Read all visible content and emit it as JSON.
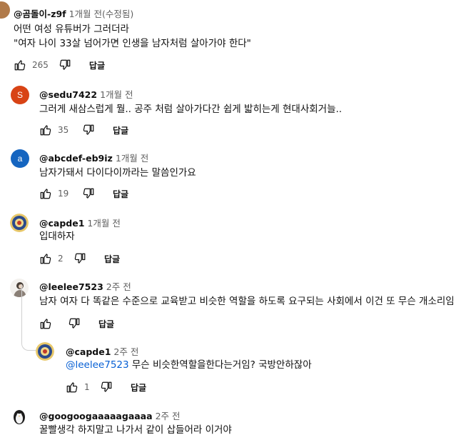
{
  "comments": [
    {
      "handle": "@곰돌이-z9f",
      "time": "1개월 전(수정됨)",
      "lines": [
        "어떤 여성 유튜버가 그러더라",
        "\"여자 나이 33살 넘어가면 인생을 남자처럼 살아가야 한다\""
      ],
      "likes": "265",
      "reply_label": "답글"
    },
    {
      "handle": "@sedu7422",
      "time": "1개월 전",
      "avatar_letter": "S",
      "avatar_color": "#d84315",
      "lines": [
        "그러게 새삼스럽게 뭘.. 공주 처럼 살아가다간 쉽게 밟히는게 현대사회거늘.."
      ],
      "likes": "35",
      "reply_label": "답글"
    },
    {
      "handle": "@abcdef-eb9iz",
      "time": "1개월 전",
      "avatar_letter": "a",
      "avatar_color": "#1565c0",
      "lines": [
        "남자가돼서 다이다이까라는 말씀인가요"
      ],
      "likes": "19",
      "reply_label": "답글"
    },
    {
      "handle": "@capde1",
      "time": "1개월 전",
      "lines": [
        "입대하자"
      ],
      "likes": "2",
      "reply_label": "답글"
    },
    {
      "handle": "@leelee7523",
      "time": "2주 전",
      "lines": [
        "남자 여자 다 똑같은 수준으로 교육받고 비슷한 역할을 하도록 요구되는 사회에서 이건 또 무슨 개소리임"
      ],
      "likes": "",
      "reply_label": "답글"
    },
    {
      "handle": "@capde1",
      "time": "2주 전",
      "mention": "@leelee7523",
      "lines": [
        " 무슨 비슷한역할을한다는거임? 국방안하잖아"
      ],
      "likes": "1",
      "reply_label": "답글"
    },
    {
      "handle": "@googoogaaaaagaaaa",
      "time": "2주 전",
      "lines": [
        "꿀빨생각 하지말고 나가서 같이 삽들어라 이거야"
      ],
      "likes": "",
      "reply_label": ""
    }
  ]
}
